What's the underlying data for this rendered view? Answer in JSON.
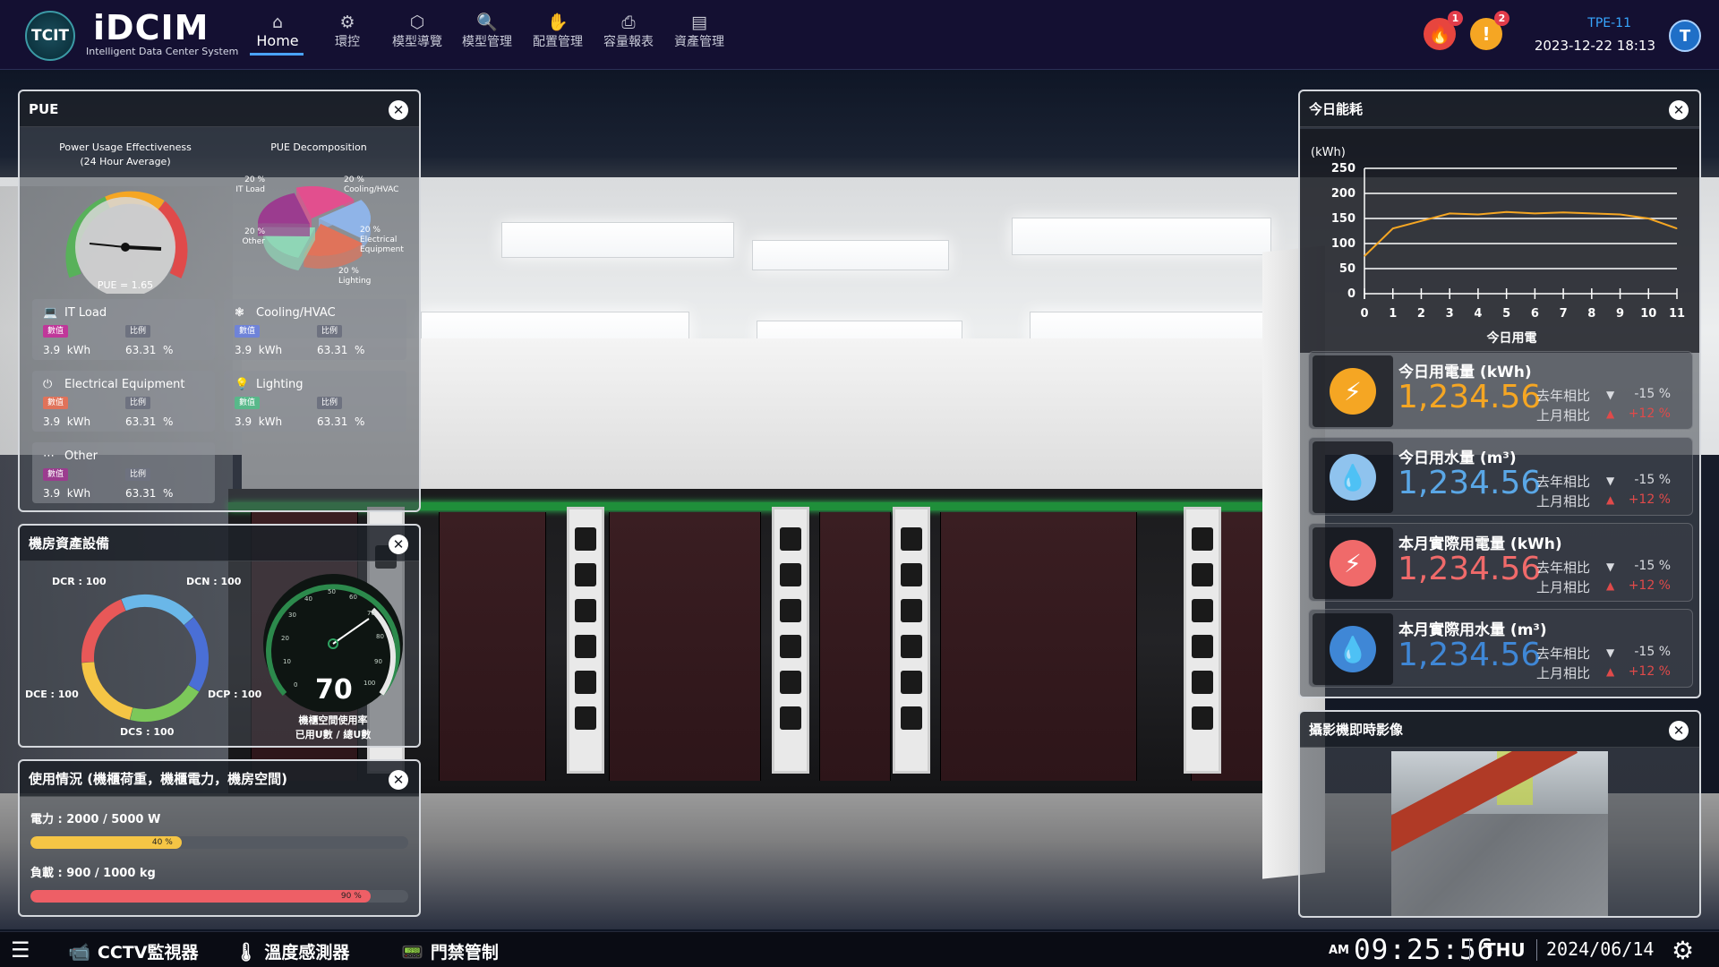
{
  "header": {
    "logo_mark": "TCIT",
    "app_name": "iDCIM",
    "app_subtitle": "Intelligent Data Center System",
    "nav": [
      {
        "label": "Home",
        "icon": "home-icon"
      },
      {
        "label": "環控",
        "icon": "gear-icon"
      },
      {
        "label": "模型導覽",
        "icon": "cube-icon"
      },
      {
        "label": "模型管理",
        "icon": "model-search-icon"
      },
      {
        "label": "配置管理",
        "icon": "hand-icon"
      },
      {
        "label": "容量報表",
        "icon": "printer-icon"
      },
      {
        "label": "資產管理",
        "icon": "clipboard-icon"
      }
    ],
    "fire_alarm_count": "1",
    "warning_alarm_count": "2",
    "site": "TPE-11",
    "datetime": "2023-12-22 18:13",
    "user_initial": "T"
  },
  "pue_panel": {
    "title": "PUE",
    "gauge_title_line1": "Power Usage Effectiveness",
    "gauge_title_line2": "(24 Hour Average)",
    "gauge_value_label": "PUE = 1.65",
    "decomp_title": "PUE Decomposition",
    "decomp_slices": [
      {
        "name": "IT Load",
        "pct": "20 %",
        "color": "#e24f8e"
      },
      {
        "name": "Cooling/HVAC",
        "pct": "20 %",
        "color": "#8fb4e8"
      },
      {
        "name": "Electrical Equipment",
        "pct": "20 %",
        "color": "#e0735a"
      },
      {
        "name": "Lighting",
        "pct": "20 %",
        "color": "#8fd6b6"
      },
      {
        "name": "Other",
        "pct": "20 %",
        "color": "#9b3c8f"
      }
    ],
    "tiles": [
      {
        "name": "IT Load",
        "icon": "laptop-icon",
        "tag_color": "#c0379a",
        "value": "3.9",
        "unit": "kWh",
        "ratio": "63.31",
        "ratio_unit": "%"
      },
      {
        "name": "Cooling/HVAC",
        "icon": "fan-icon",
        "tag_color": "#6f83d8",
        "value": "3.9",
        "unit": "kWh",
        "ratio": "63.31",
        "ratio_unit": "%"
      },
      {
        "name": "Electrical Equipment",
        "icon": "electric-plug-icon",
        "tag_color": "#e0735a",
        "value": "3.9",
        "unit": "kWh",
        "ratio": "63.31",
        "ratio_unit": "%"
      },
      {
        "name": "Lighting",
        "icon": "lightbulb-icon",
        "tag_color": "#58b88a",
        "value": "3.9",
        "unit": "kWh",
        "ratio": "63.31",
        "ratio_unit": "%"
      },
      {
        "name": "Other",
        "icon": "more-icon",
        "tag_color": "#9b3c8f",
        "value": "3.9",
        "unit": "kWh",
        "ratio": "63.31",
        "ratio_unit": "%"
      }
    ],
    "tag_value_label": "數值",
    "tag_ratio_label": "比例"
  },
  "asset_panel": {
    "title": "機房資產設備",
    "ring_labels": [
      "DCR : 100",
      "DCN : 100",
      "DCE : 100",
      "DCP : 100",
      "DCS : 100"
    ],
    "gauge_value": "70",
    "gauge_ticks": [
      "0",
      "10",
      "20",
      "30",
      "40",
      "50",
      "60",
      "70",
      "80",
      "90",
      "100"
    ],
    "gauge_caption_line1": "機櫃空間使用率",
    "gauge_caption_line2": "已用U數 / 總U數"
  },
  "usage_panel": {
    "title": "使用情況 (機櫃荷重，機櫃電力，機房空間)",
    "power_label": "電力 : 2000 / 5000 W",
    "power_pct_label": "40 %",
    "power_pct": 0.4,
    "load_label": "負載 : 900 / 1000 kg",
    "load_pct_label": "90 %",
    "load_pct": 0.9
  },
  "energy_panel": {
    "title": "今日能耗",
    "chart_unit": "(kWh)",
    "chart_xlabel": "今日用電",
    "cards": [
      {
        "title": "今日用電量 (kWh)",
        "value": "1,234.56",
        "color": "#f5a623",
        "icon": "lightning-icon",
        "icon_bg": "#f5a623",
        "yoy_label": "去年相比",
        "yoy": "-15 %",
        "mom_label": "上月相比",
        "mom": "+12 %"
      },
      {
        "title": "今日用水量 (m³)",
        "value": "1,234.56",
        "color": "#5aa7e6",
        "icon": "water-drop-icon",
        "icon_bg": "#8fc3ee",
        "yoy_label": "去年相比",
        "yoy": "-15 %",
        "mom_label": "上月相比",
        "mom": "+12 %"
      },
      {
        "title": "本月實際用電量 (kWh)",
        "value": "1,234.56",
        "color": "#f06a6a",
        "icon": "lightning-icon",
        "icon_bg": "#f06a6a",
        "yoy_label": "去年相比",
        "yoy": "-15 %",
        "mom_label": "上月相比",
        "mom": "+12 %"
      },
      {
        "title": "本月實際用水量 (m³)",
        "value": "1,234.56",
        "color": "#3f87d6",
        "icon": "water-drop-icon",
        "icon_bg": "#3f87d6",
        "yoy_label": "去年相比",
        "yoy": "-15 %",
        "mom_label": "上月相比",
        "mom": "+12 %"
      }
    ]
  },
  "camera_panel": {
    "title": "攝影機即時影像"
  },
  "bottombar": {
    "items": [
      {
        "label": "CCTV監視器",
        "icon": "cctv-icon"
      },
      {
        "label": "溫度感測器",
        "icon": "thermometer-icon"
      },
      {
        "label": "門禁管制",
        "icon": "access-card-icon"
      }
    ],
    "ampm": "AM",
    "time": "09:25:56",
    "day": "THU",
    "date": "2024/06/14"
  },
  "chart_data": [
    {
      "type": "line",
      "title": "今日能耗",
      "ylabel": "(kWh)",
      "xlabel": "今日用電",
      "x": [
        0,
        1,
        2,
        3,
        4,
        5,
        6,
        7,
        8,
        9,
        10,
        11
      ],
      "ylim": [
        0,
        250
      ],
      "yticks": [
        0,
        50,
        100,
        150,
        200,
        250
      ],
      "series": [
        {
          "values": [
            75,
            130,
            145,
            160,
            158,
            163,
            160,
            162,
            160,
            158,
            150,
            130
          ]
        }
      ],
      "color": "#f5a623",
      "grid": true
    },
    {
      "type": "pie",
      "title": "PUE Decomposition",
      "categories": [
        "IT Load",
        "Cooling/HVAC",
        "Electrical Equipment",
        "Lighting",
        "Other"
      ],
      "values": [
        20,
        20,
        20,
        20,
        20
      ]
    },
    {
      "type": "bar",
      "categories": [
        "電力",
        "負載"
      ],
      "values": [
        40,
        90
      ],
      "ylim": [
        0,
        100
      ]
    }
  ]
}
